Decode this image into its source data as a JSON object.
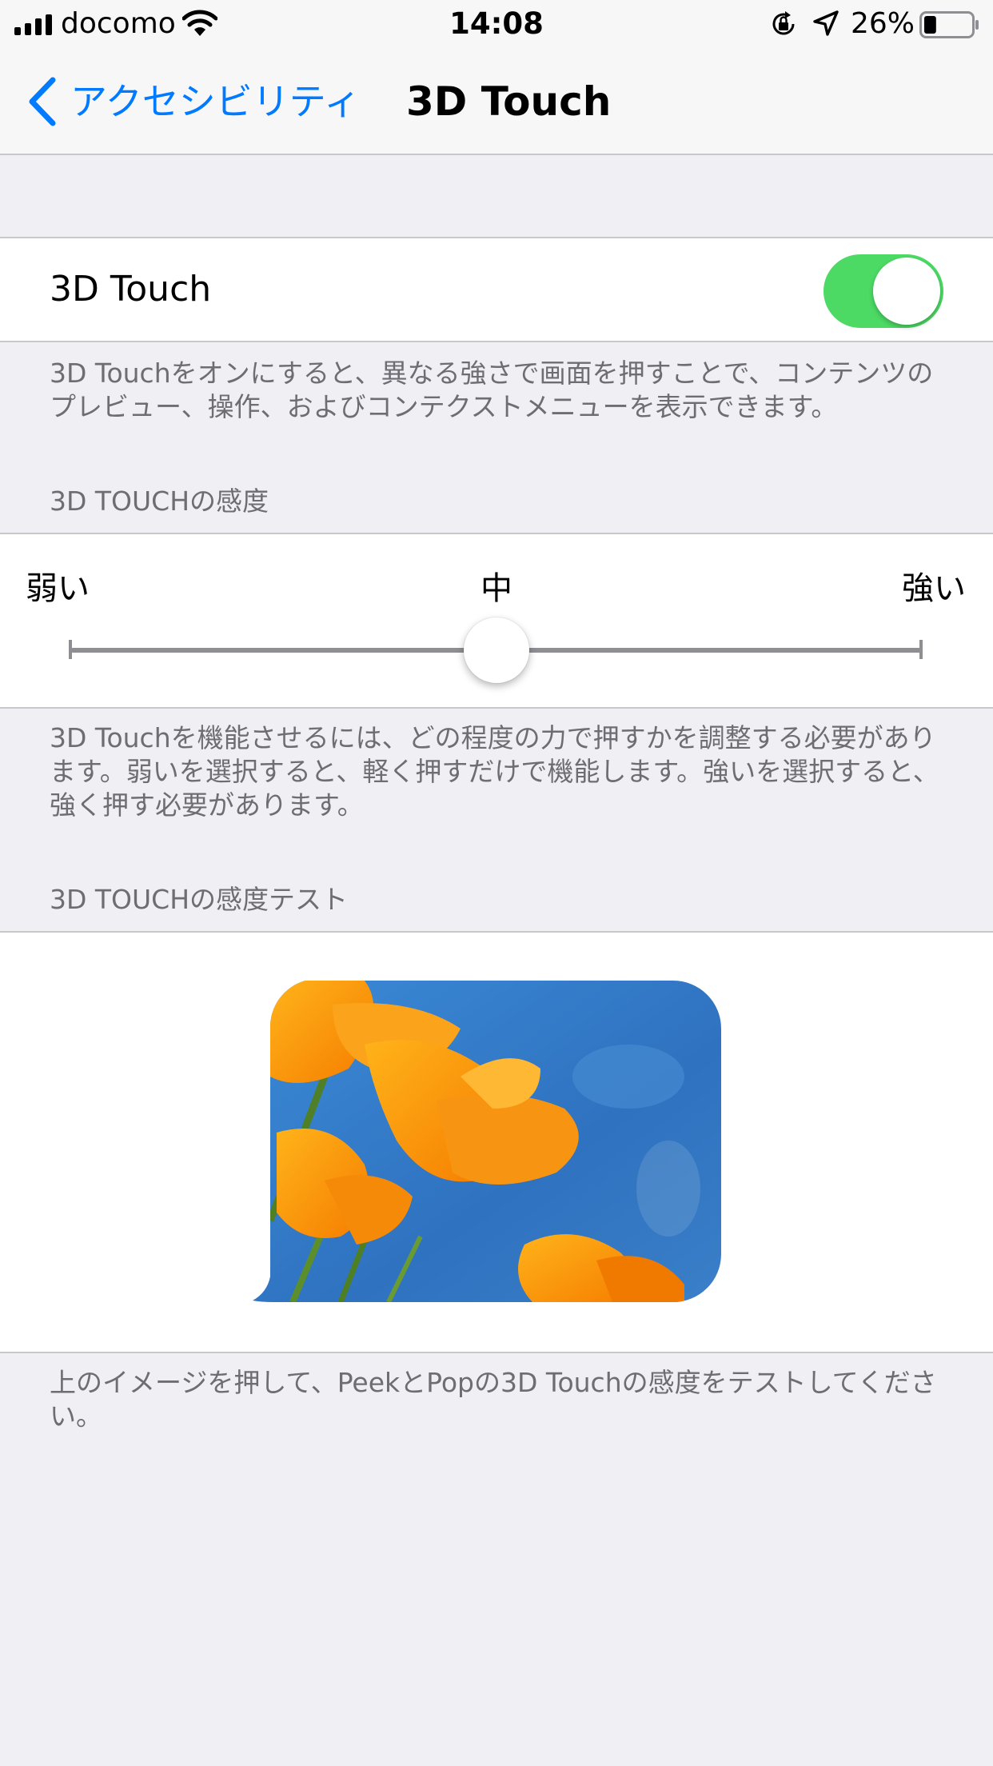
{
  "status_bar": {
    "carrier": "docomo",
    "time": "14:08",
    "battery_percent": "26%",
    "battery_level": 0.26,
    "icons": [
      "signal-icon",
      "wifi-icon",
      "rotation-lock-icon",
      "location-icon",
      "battery-icon"
    ]
  },
  "nav": {
    "back_label": "アクセシビリティ",
    "title": "3D Touch"
  },
  "toggle_row": {
    "label": "3D Touch",
    "enabled": true
  },
  "toggle_footer": "3D Touchをオンにすると、異なる強さで画面を押すことで、コンテンツのプレビュー、操作、およびコンテクストメニューを表示できます。",
  "sensitivity": {
    "header": "3D TOUCHの感度",
    "low_label": "弱い",
    "mid_label": "中",
    "high_label": "強い",
    "value_fraction": 0.5
  },
  "sensitivity_footer": "3D Touchを機能させるには、どの程度の力で押すかを調整する必要があります。弱いを選択すると、軽く押すだけで機能します。強いを選択すると、強く押す必要があります。",
  "test": {
    "header": "3D TOUCHの感度テスト",
    "image_name": "orange-poppy-flower-image"
  },
  "test_footer": "上のイメージを押して、PeekとPopの3D Touchの感度をテストしてください。",
  "colors": {
    "accent": "#007aff",
    "toggle_on": "#4cd964",
    "background": "#efeff4",
    "secondary_text": "#6d6d72"
  }
}
